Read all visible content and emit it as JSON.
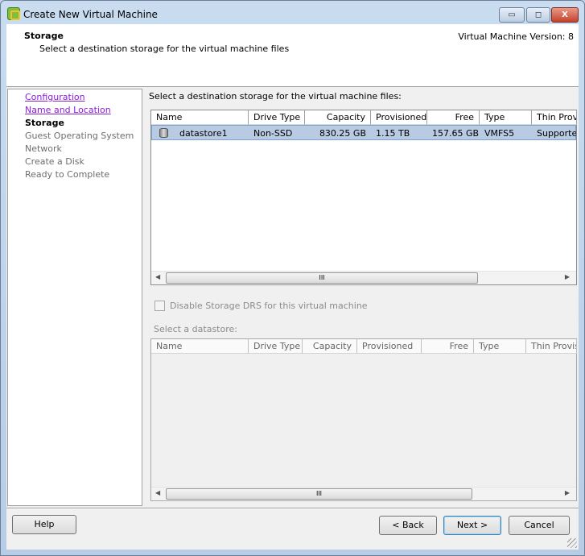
{
  "window": {
    "title": "Create New Virtual Machine",
    "minimize": "▭",
    "maximize": "◻",
    "close": "X"
  },
  "header": {
    "step": "Storage",
    "description": "Select a destination storage for the virtual machine files",
    "version": "Virtual Machine Version: 8"
  },
  "nav": {
    "items": [
      {
        "label": "Configuration",
        "state": "visited"
      },
      {
        "label": "Name and Location",
        "state": "visited"
      },
      {
        "label": "Storage",
        "state": "current"
      },
      {
        "label": "Guest Operating System",
        "state": "disabled"
      },
      {
        "label": "Network",
        "state": "disabled"
      },
      {
        "label": "Create a Disk",
        "state": "disabled"
      },
      {
        "label": "Ready to Complete",
        "state": "disabled"
      }
    ]
  },
  "main": {
    "prompt": "Select a destination storage for the virtual machine files:",
    "columns": [
      "Name",
      "Drive Type",
      "Capacity",
      "Provisioned",
      "Free",
      "Type",
      "Thin Provisioning"
    ],
    "rows": [
      {
        "name": "datastore1",
        "drive_type": "Non-SSD",
        "capacity": "830.25 GB",
        "provisioned": "1.15 TB",
        "free": "157.65 GB",
        "type": "VMFS5",
        "thin": "Supported",
        "icon": "datastore-icon",
        "selected": true
      }
    ],
    "scroll_grip": "III",
    "disable_drs": {
      "label": "Disable Storage DRS for this virtual machine",
      "checked": false,
      "enabled": false
    },
    "select_label": "Select a datastore:",
    "columns2": [
      "Name",
      "Drive Type",
      "Capacity",
      "Provisioned",
      "Free",
      "Type",
      "Thin Provisioning"
    ]
  },
  "footer": {
    "help": "Help",
    "back": "< Back",
    "next": "Next >",
    "cancel": "Cancel"
  }
}
